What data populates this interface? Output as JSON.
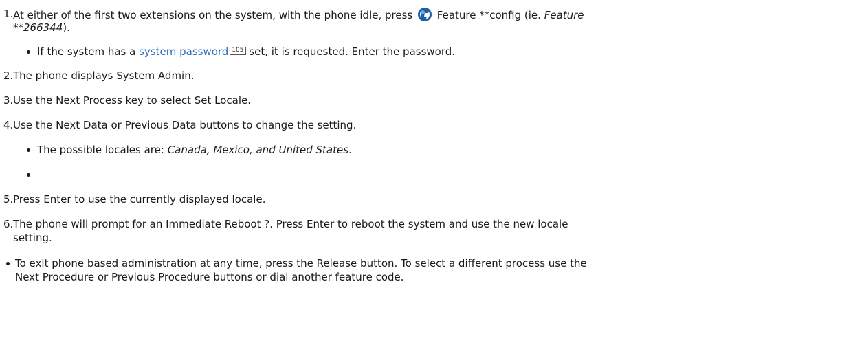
{
  "steps": [
    {
      "number": "1.",
      "pre_icon": "At either of the first two extensions on the system, with the phone idle, press",
      "icon": "feature-key-icon",
      "post_icon": "Feature **config (ie.",
      "example_line1": "Feature",
      "example_line2": "**266344",
      "example_tail": ").",
      "sub": {
        "pre_link": "If the system has a",
        "link_text": "system password",
        "page_ref": "105",
        "post_link": "set, it is requested. Enter the password."
      }
    },
    {
      "number": "2.",
      "text": "The phone displays System Admin."
    },
    {
      "number": "3.",
      "text": "Use the Next Process key to select Set Locale."
    },
    {
      "number": "4.",
      "text": "Use the Next Data or Previous Data buttons to change the setting.",
      "sub": {
        "pre": "The possible locales are:",
        "locales": "Canada, Mexico, and United States",
        "post": "."
      }
    },
    {
      "number": "5.",
      "text": "Press Enter to use the currently displayed locale."
    },
    {
      "number": "6.",
      "line1": "The phone will prompt for an Immediate Reboot ?. Press Enter to reboot the system and use the new locale",
      "line2": "setting."
    }
  ],
  "note": {
    "line1": "To exit phone based administration at any time, press the Release button. To select a different process use the",
    "line2": "Next Procedure or Previous Procedure buttons or dial another feature code."
  },
  "colors": {
    "link": "#2a6ebb",
    "text": "#1a1a1a",
    "icon": "#1d5fa8"
  }
}
